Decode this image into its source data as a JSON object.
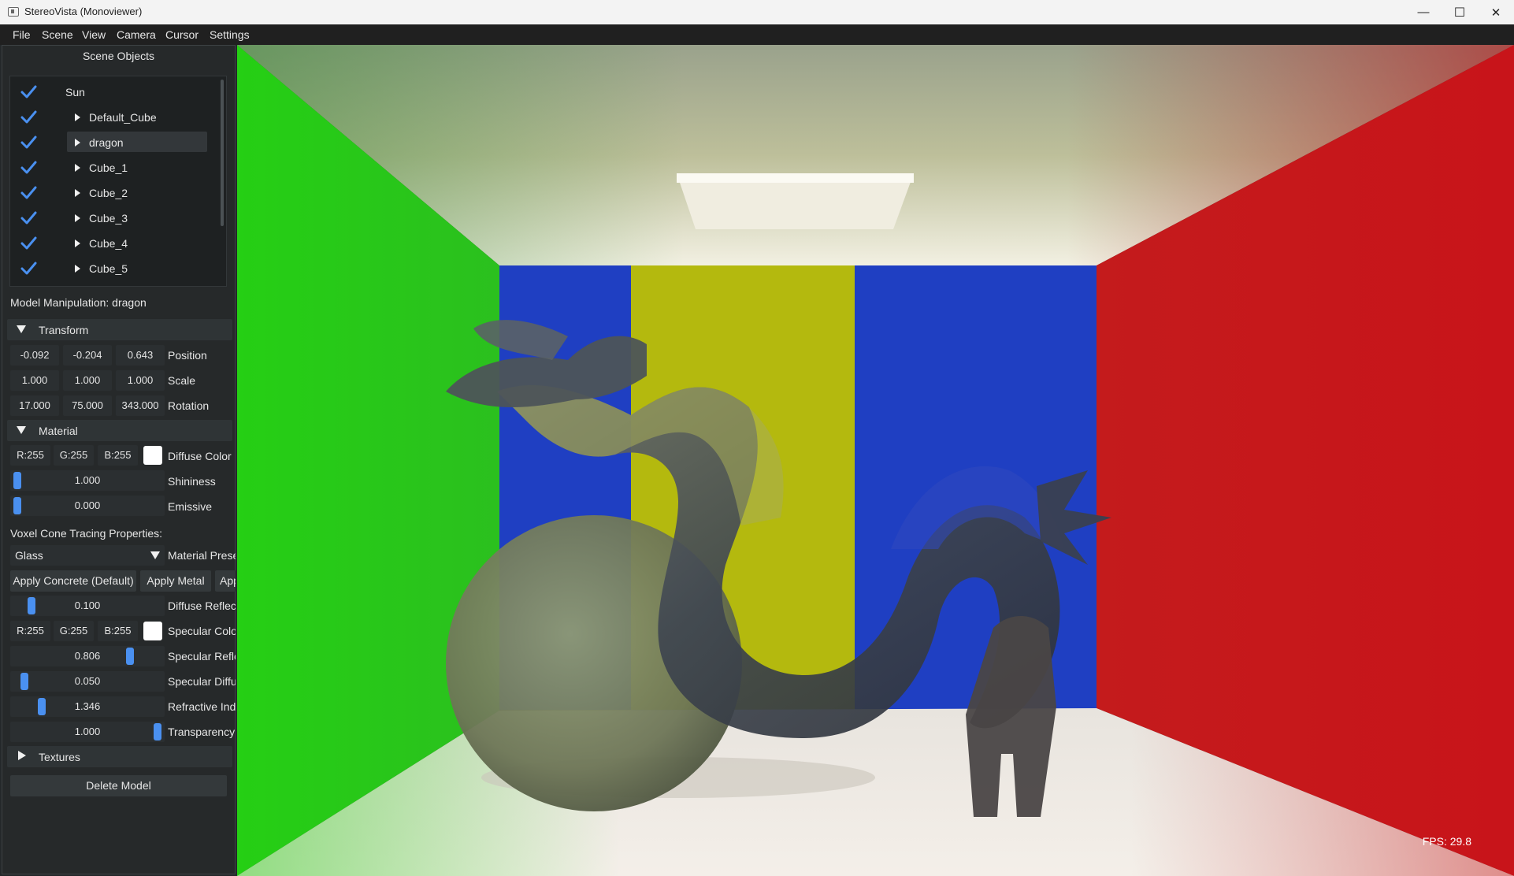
{
  "window": {
    "title": "StereoVista (Monoviewer)"
  },
  "window_controls": {
    "minimize": "—",
    "maximize": "☐",
    "close": "✕"
  },
  "menu": [
    "File",
    "Scene",
    "View",
    "Camera",
    "Cursor",
    "Settings"
  ],
  "scene_objects": {
    "title": "Scene Objects",
    "items": [
      {
        "label": "Sun",
        "checked": true,
        "expandable": false
      },
      {
        "label": "Default_Cube",
        "checked": true,
        "expandable": true
      },
      {
        "label": "dragon",
        "checked": true,
        "expandable": true,
        "selected": true
      },
      {
        "label": "Cube_1",
        "checked": true,
        "expandable": true
      },
      {
        "label": "Cube_2",
        "checked": true,
        "expandable": true
      },
      {
        "label": "Cube_3",
        "checked": true,
        "expandable": true
      },
      {
        "label": "Cube_4",
        "checked": true,
        "expandable": true
      },
      {
        "label": "Cube_5",
        "checked": true,
        "expandable": true
      }
    ]
  },
  "model_manipulation": {
    "heading": "Model Manipulation: dragon",
    "transform": {
      "header": "Transform",
      "position": {
        "x": "-0.092",
        "y": "-0.204",
        "z": "0.643",
        "label": "Position"
      },
      "scale": {
        "x": "1.000",
        "y": "1.000",
        "z": "1.000",
        "label": "Scale"
      },
      "rotation": {
        "x": "17.000",
        "y": "75.000",
        "z": "343.000",
        "label": "Rotation"
      }
    },
    "material": {
      "header": "Material",
      "diffuse": {
        "r": "R:255",
        "g": "G:255",
        "b": "B:255",
        "label": "Diffuse Color",
        "color": "#ffffff"
      },
      "shininess": {
        "value": "1.000",
        "label": "Shininess",
        "level": 0.0
      },
      "emissive": {
        "value": "0.000",
        "label": "Emissive",
        "level": 0.0
      }
    }
  },
  "vct": {
    "heading": "Voxel Cone Tracing Properties:",
    "preset": {
      "value": "Glass",
      "label": "Material Prese"
    },
    "buttons": [
      "Apply Concrete (Default)",
      "Apply Metal",
      "App"
    ],
    "diffuse_reflectivity": {
      "value": "0.100",
      "label": "Diffuse Reflect",
      "level": 0.1
    },
    "specular_color": {
      "r": "R:255",
      "g": "G:255",
      "b": "B:255",
      "label": "Specular Color",
      "color": "#ffffff"
    },
    "specular_reflectivity": {
      "value": "0.806",
      "label": "Specular Refle",
      "level": 0.806
    },
    "specular_diffusion": {
      "value": "0.050",
      "label": "Specular Diffus",
      "level": 0.05
    },
    "refractive_index": {
      "value": "1.346",
      "label": "Refractive Inde",
      "level": 0.173
    },
    "transparency": {
      "value": "1.000",
      "label": "Transparency",
      "level": 1.0
    }
  },
  "textures": {
    "header": "Textures"
  },
  "delete_button": "Delete Model",
  "viewport": {
    "fps": "FPS: 29.8"
  },
  "colors": {
    "accent": "#4a90f0",
    "panel_bg": "#26292a",
    "green_wall": "#22c31a",
    "red_wall": "#c3161a",
    "blue_wall": "#1f3fc2",
    "yellow_panel": "#b8bb0f"
  }
}
